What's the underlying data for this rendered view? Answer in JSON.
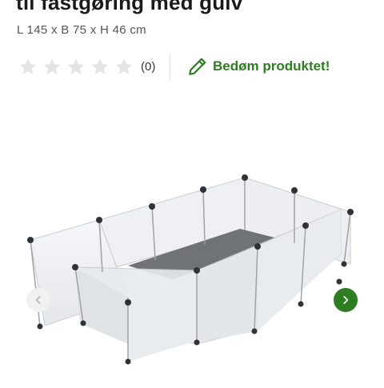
{
  "product": {
    "title": "til fastgøring med gulv",
    "dimensions": "L 145 x B 75 x H 46 cm",
    "image_alt": ""
  },
  "rating": {
    "stars_filled": 0,
    "stars_total": 5,
    "review_count": "(0)",
    "rate_label": "Bedøm produktet!"
  },
  "colors": {
    "accent": "#2e7d22",
    "star_empty": "#e4e4e4"
  },
  "icons": {
    "star": "star-icon",
    "rate": "pencil-icon",
    "prev": "chevron-left-icon",
    "next": "chevron-right-icon"
  }
}
